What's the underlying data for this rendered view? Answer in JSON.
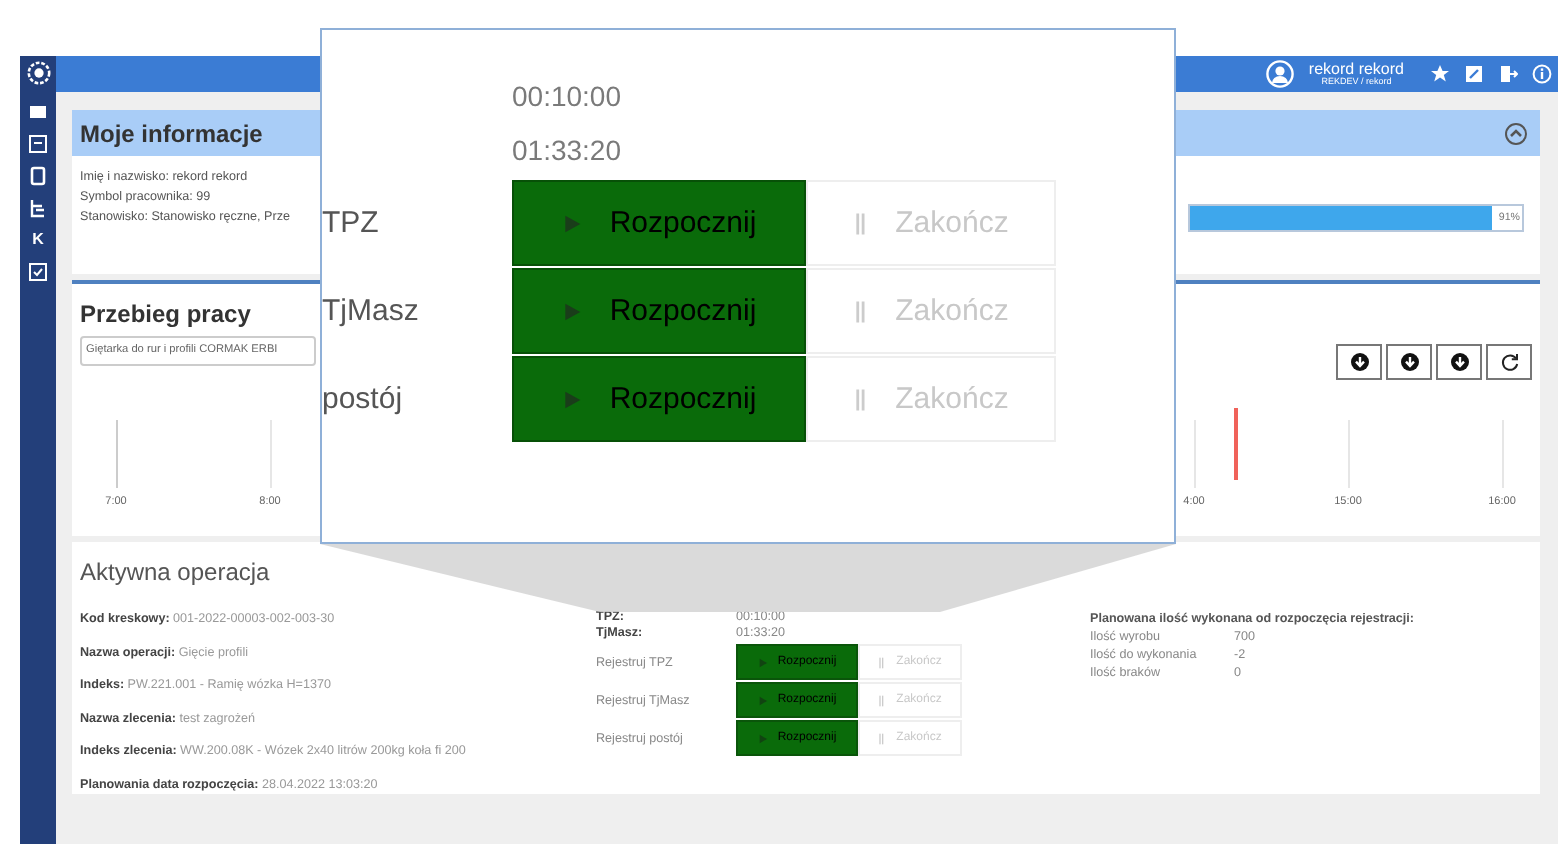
{
  "header": {
    "user_name": "rekord rekord",
    "user_sub": "REKDEV / rekord"
  },
  "sidebar": {
    "letter_item": "K"
  },
  "info_card": {
    "title": "Moje informacje",
    "lines": [
      "Imię i nazwisko: rekord rekord",
      "Symbol pracownika: 99",
      "Stanowisko: Stanowisko ręczne, Prze"
    ],
    "progress": {
      "level": 0.91,
      "label": "91%"
    }
  },
  "work_card": {
    "title": "Przebieg pracy",
    "machine": "Giętarka do rur i profili CORMAK ERBI",
    "timeline_labels": [
      "7:00",
      "8:00",
      "4:00",
      "15:00",
      "16:00"
    ]
  },
  "active_operation": {
    "title": "Aktywna operacja",
    "fields": [
      {
        "label": "Kod kreskowy:",
        "value": "001-2022-00003-002-003-30"
      },
      {
        "label": "Nazwa operacji:",
        "value": "Gięcie profili"
      },
      {
        "label": "Indeks:",
        "value": "PW.221.001 - Ramię wózka H=1370"
      },
      {
        "label": "Nazwa zlecenia:",
        "value": "test zagrożeń"
      },
      {
        "label": "Indeks zlecenia:",
        "value": "WW.200.08K - Wózek 2x40 litrów 200kg koła fi 200"
      },
      {
        "label": "Planowania data rozpoczęcia:",
        "value": "28.04.2022 13:03:20"
      }
    ],
    "times": [
      {
        "label": "TPZ:",
        "value": "00:10:00"
      },
      {
        "label": "TjMasz:",
        "value": "01:33:20"
      }
    ],
    "registers": [
      {
        "label": "Rejestruj TPZ",
        "start": "Rozpocznij",
        "stop": "Zakończ",
        "stop_disabled": true
      },
      {
        "label": "Rejestruj TjMasz",
        "start": "Rozpocznij",
        "stop": "Zakończ",
        "stop_disabled": true
      },
      {
        "label": "Rejestruj postój",
        "start": "Rozpocznij",
        "stop": "Zakończ",
        "stop_disabled": true
      }
    ],
    "planned": {
      "title": "Planowana ilość wykonana od rozpoczęcia rejestracji:",
      "rows": [
        {
          "label": "Ilość wyrobu",
          "value": "700"
        },
        {
          "label": "Ilość do wykonania",
          "value": "-2"
        },
        {
          "label": "Ilość braków",
          "value": "0"
        }
      ]
    }
  },
  "magnifier": {
    "times": [
      "00:10:00",
      "01:33:20"
    ],
    "rows": [
      {
        "label": "TPZ",
        "start": "Rozpocznij",
        "stop": "Zakończ",
        "stop_disabled": true
      },
      {
        "label": "TjMasz",
        "start": "Rozpocznij",
        "stop": "Zakończ",
        "stop_disabled": true
      },
      {
        "label": "postój",
        "start": "Rozpocznij",
        "stop": "Zakończ",
        "stop_disabled": true
      }
    ]
  }
}
